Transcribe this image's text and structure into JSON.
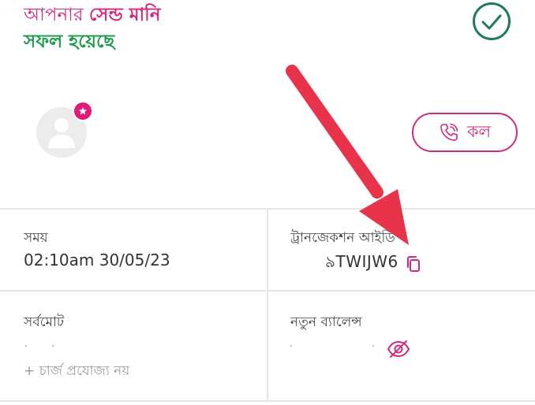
{
  "header": {
    "title_prefix": "আপনার",
    "title_emph": "সেন্ড মানি",
    "title_line2": "সফল হয়েছে"
  },
  "contact": {
    "call_label": "কল"
  },
  "details": {
    "time_label": "সময়",
    "time_value": "02:10am 30/05/23",
    "txn_label": "ট্রানজেকশন আইডি",
    "txn_value": "৯TWIJW6",
    "total_label": "সর্বমোট",
    "charge_note": "+ চার্জ প্রযোজ্য নয়",
    "balance_label": "নতুন ব্যালেন্স"
  },
  "icons": {
    "success": "check-circle-icon",
    "avatar": "user-icon",
    "badge": "star-icon",
    "call": "phone-icon",
    "copy": "copy-icon",
    "balance_visibility": "eye-slash-icon"
  },
  "colors": {
    "brand_pink": "#d12a7d",
    "success_green": "#1a9a4a",
    "check_teal": "#1e7a62",
    "annotation_red": "#e8334a"
  }
}
